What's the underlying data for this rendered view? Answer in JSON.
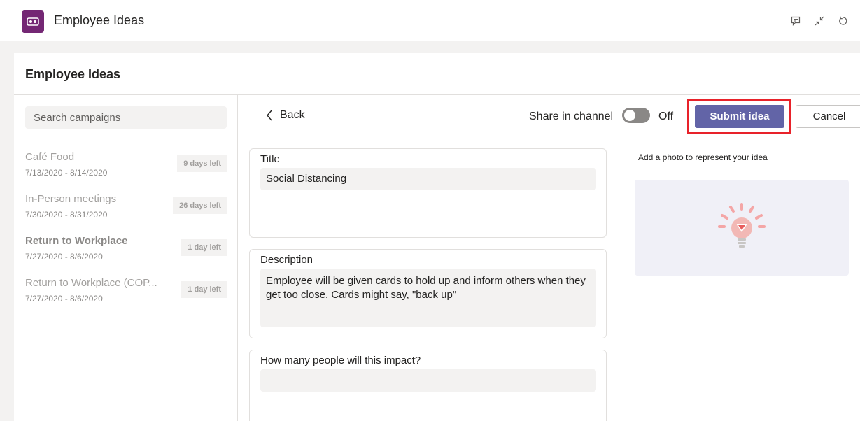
{
  "app": {
    "title": "Employee Ideas",
    "icon": "employee-ideas-app-icon",
    "brand_color": "#742774"
  },
  "appbar": {
    "actions": [
      "chat-icon",
      "collapse-icon",
      "refresh-icon"
    ]
  },
  "panel": {
    "title": "Employee Ideas"
  },
  "sidebar": {
    "search_placeholder": "Search campaigns",
    "campaigns": [
      {
        "name": "Café Food",
        "dates": "7/13/2020 - 8/14/2020",
        "badge": "9 days left",
        "selected": false
      },
      {
        "name": "In-Person meetings",
        "dates": "7/30/2020 - 8/31/2020",
        "badge": "26 days left",
        "selected": false
      },
      {
        "name": "Return to Workplace",
        "dates": "7/27/2020 - 8/6/2020",
        "badge": "1 day left",
        "selected": true
      },
      {
        "name": "Return to Workplace (COP...",
        "dates": "7/27/2020 - 8/6/2020",
        "badge": "1 day left",
        "selected": false
      }
    ]
  },
  "form": {
    "back_label": "Back",
    "share_label": "Share in channel",
    "share_state": "Off",
    "submit_label": "Submit idea",
    "cancel_label": "Cancel",
    "accent_color": "#6264a7",
    "highlight_color": "#e8222a",
    "fields": [
      {
        "label": "Title",
        "value": "Social Distancing"
      },
      {
        "label": "Description",
        "value": "Employee will be given cards to hold up and inform others when they get too close. Cards might say, \"back up\""
      },
      {
        "label": "How many people will this impact?",
        "value": ""
      }
    ],
    "photo_label": "Add a photo to represent your idea",
    "photo_icon": "lightbulb-icon"
  }
}
